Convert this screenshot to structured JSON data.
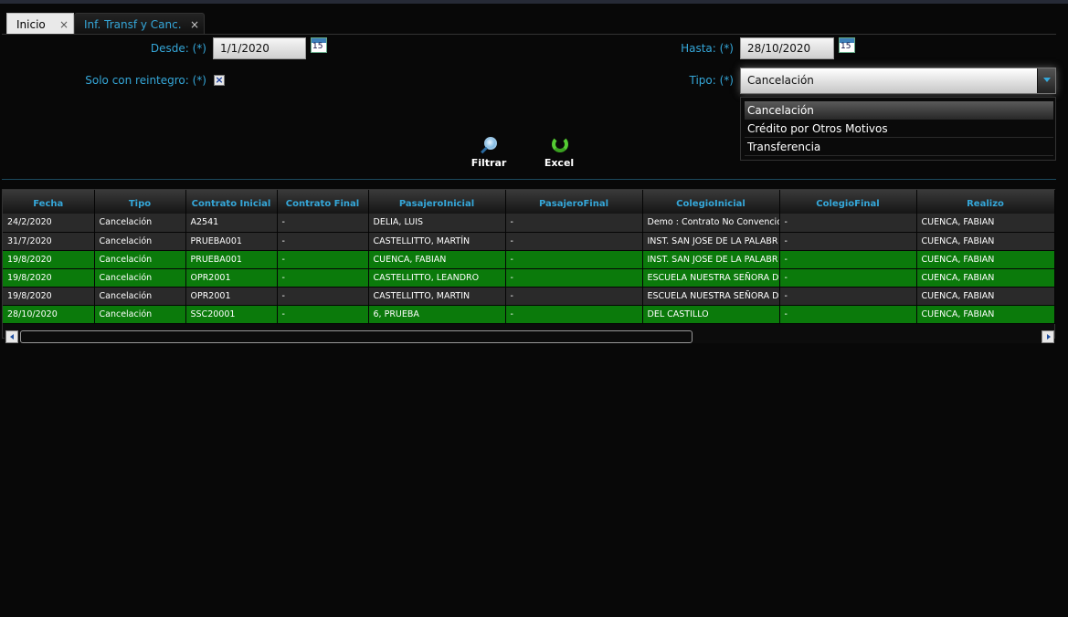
{
  "tabs": [
    {
      "label": "Inicio",
      "close": "×"
    },
    {
      "label": "Inf. Transf y Canc.",
      "close": "×"
    }
  ],
  "filters": {
    "desde_label": "Desde: (*)",
    "desde_value": "1/1/2020",
    "hasta_label": "Hasta: (*)",
    "hasta_value": "28/10/2020",
    "calendar_day": "15",
    "reintegro_label": "Solo con reintegro: (*)",
    "reintegro_mark": "×",
    "tipo_label": "Tipo: (*)",
    "tipo_value": "Cancelación",
    "tipo_options": [
      "Cancelación",
      "Crédito por Otros Motivos",
      "Transferencia"
    ]
  },
  "toolbar": {
    "filtrar_label": "Filtrar",
    "excel_label": "Excel"
  },
  "table": {
    "columns": [
      "Fecha",
      "Tipo",
      "Contrato Inicial",
      "Contrato Final",
      "PasajeroInicial",
      "PasajeroFinal",
      "ColegioInicial",
      "ColegioFinal",
      "Realizo"
    ],
    "rows": [
      {
        "style": "gray",
        "cells": [
          "24/2/2020",
          "Cancelación",
          "A2541",
          "-",
          "DELIA, LUIS",
          "-",
          "Demo : Contrato No Convencio",
          "-",
          "CUENCA, FABIAN"
        ]
      },
      {
        "style": "gray",
        "cells": [
          "31/7/2020",
          "Cancelación",
          "PRUEBA001",
          "-",
          "CASTELLITTO, MARTÍN",
          "-",
          "INST. SAN JOSE DE LA PALABR",
          "-",
          "CUENCA, FABIAN"
        ]
      },
      {
        "style": "green",
        "cells": [
          "19/8/2020",
          "Cancelación",
          "PRUEBA001",
          "-",
          "CUENCA, FABIAN",
          "-",
          "INST. SAN JOSE DE LA PALABR",
          "-",
          "CUENCA, FABIAN"
        ]
      },
      {
        "style": "green",
        "cells": [
          "19/8/2020",
          "Cancelación",
          "OPR2001",
          "-",
          "CASTELLITTO, LEANDRO",
          "-",
          "ESCUELA NUESTRA SEÑORA D",
          "-",
          "CUENCA, FABIAN"
        ]
      },
      {
        "style": "gray",
        "cells": [
          "19/8/2020",
          "Cancelación",
          "OPR2001",
          "-",
          "CASTELLITTO, MARTIN",
          "-",
          "ESCUELA NUESTRA SEÑORA D",
          "-",
          "CUENCA, FABIAN"
        ]
      },
      {
        "style": "green",
        "cells": [
          "28/10/2020",
          "Cancelación",
          "SSC20001",
          "-",
          "6, PRUEBA",
          "-",
          "DEL CASTILLO",
          "-",
          "CUENCA, FABIAN"
        ]
      }
    ]
  },
  "colors": {
    "accent": "#35a7d9",
    "row_gray": "#2a2a2a",
    "row_green": "#0b7a0b",
    "background": "#080808"
  },
  "icons": {
    "filtrar": "magnifier-icon",
    "excel": "refresh-icon",
    "calendar": "calendar-icon",
    "scroll_left": "arrow-left-icon",
    "scroll_right": "arrow-right-icon"
  }
}
